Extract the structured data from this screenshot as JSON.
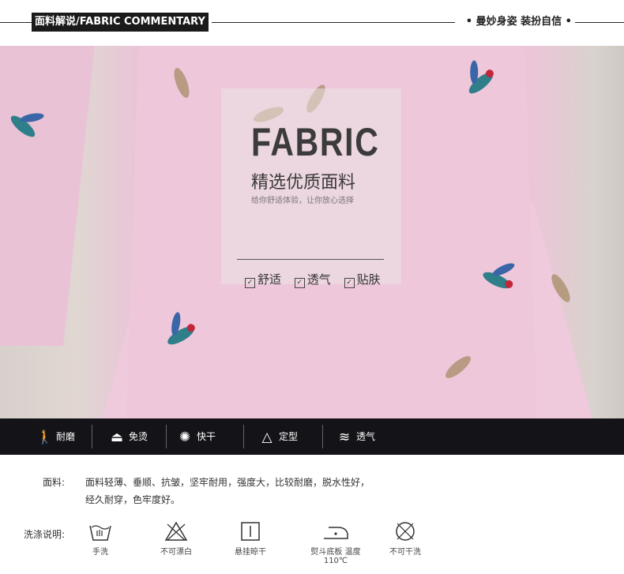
{
  "header": {
    "title": "面料解说/FABRIC COMMENTARY",
    "slogan": "• 曼妙身姿 装扮自信 •"
  },
  "overlay": {
    "title": "FABRIC",
    "subtitle": "精选优质面料",
    "small": "给你舒适体验，让你放心选择",
    "checks": [
      "舒适",
      "透气",
      "贴肤"
    ]
  },
  "features": [
    {
      "icon": "walking-person-icon",
      "label": "耐磨"
    },
    {
      "icon": "iron-icon",
      "label": "免烫"
    },
    {
      "icon": "sun-icon",
      "label": "快干"
    },
    {
      "icon": "triangle-icon",
      "label": "定型"
    },
    {
      "icon": "waves-icon",
      "label": "透气"
    }
  ],
  "material": {
    "label": "面料:",
    "line1": "面料轻薄、垂顺、抗皱，坚牢耐用，强度大，比较耐磨，脱水性好，",
    "line2": "经久耐穿，色牢度好。"
  },
  "wash": {
    "label": "洗涤说明:",
    "items": [
      {
        "icon": "hand-wash-icon",
        "label": "手洗"
      },
      {
        "icon": "no-bleach-icon",
        "label": "不可漂白"
      },
      {
        "icon": "hang-dry-icon",
        "label": "悬挂晾干"
      },
      {
        "icon": "iron-temp-icon",
        "label": "熨斗底板 温度110℃"
      },
      {
        "icon": "no-dry-clean-icon",
        "label": "不可干洗"
      }
    ]
  },
  "colors": {
    "bar": "#131318",
    "fabric": "#eec7da",
    "accent_bird": "#2e7f8a"
  }
}
